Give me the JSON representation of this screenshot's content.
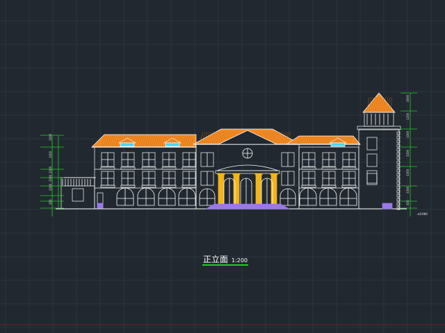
{
  "drawing": {
    "title": "正立面",
    "scale": "1:200",
    "level_marker": "±0.000",
    "dimension_labels_left": [
      "1000",
      "1000",
      "3300",
      "3300",
      "3300",
      "450"
    ],
    "dimension_labels_right": [
      "3000",
      "1200",
      "3300",
      "3300",
      "3300",
      "3300",
      "450"
    ]
  },
  "colors": {
    "background": "#212830",
    "grid": "#2c343e",
    "grid_major": "#323b46",
    "line": "#ffffff",
    "roof": "#f08a24",
    "columns": "#f2b41c",
    "steps": "#9b78e8",
    "dimension": "#22cc22",
    "dormer": "#4dd4f2",
    "title_underline": "#22cc22",
    "axis_red": "#b02020"
  }
}
